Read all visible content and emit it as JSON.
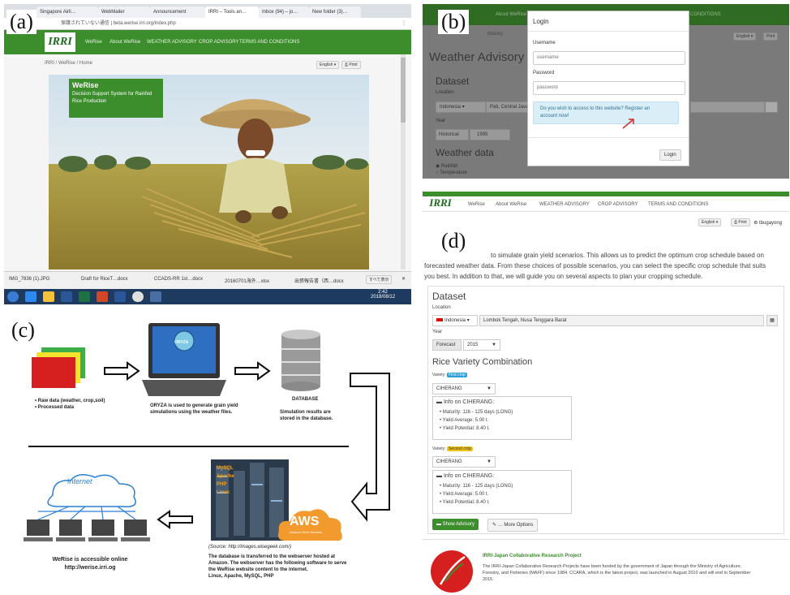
{
  "labels": {
    "a": "(a)",
    "b": "(b)",
    "c": "(c)",
    "d": "(d)"
  },
  "panel_a": {
    "tabs": [
      "Singapore Airli…",
      "WebMailer",
      "Announcement",
      "IRRI – Tools an…",
      "Inbox (94) – jo…",
      "New folder (3)…"
    ],
    "address": "保護されていない通信 | beta.werise.irri.org/index.php",
    "logo": "IRRI",
    "nav": [
      "WeRise",
      "About WeRise",
      "WEATHER ADVISORY",
      "CROP ADVISORY",
      "TERMS AND CONDITIONS"
    ],
    "breadcrumb": "IRRI / WeRise / Home",
    "lang": "English ▾",
    "print": "Print",
    "hero_title": "WeRise",
    "hero_sub": "Decision Support System for Rainfed Rice Production",
    "downloads": [
      "IMG_7836 (1).JPG",
      "Draft for RiceT…docx",
      "CCADS-RR 1st…docx",
      "20160701海外…xlsx",
      "出張報告書（西…docx"
    ],
    "show_all": "すべて表示",
    "clock": "2:42",
    "date": "2018/08/12"
  },
  "panel_b": {
    "bg_title": "Weather Advisory",
    "bg_dataset": "Dataset",
    "bg_location": "Location",
    "bg_country": "Indonesia ▾",
    "bg_region": "Pati, Central Java",
    "bg_year": "Year",
    "bg_hist": "Historical",
    "bg_year_val": "1995",
    "bg_weather": "Weather data",
    "bg_rain": "Rainfall",
    "bg_temp": "Temperature",
    "bg_nav_1": "About WeRise",
    "bg_nav_2": "CONDITIONS",
    "bg_advisory": "dvisory",
    "bg_english": "English ▾",
    "bg_print": "Print",
    "login_title": "Login",
    "username_label": "Username",
    "username_ph": "username",
    "password_label": "Password",
    "password_ph": "password",
    "msg_1": "Do you wish to access to this website? Register an",
    "msg_2": "account now!",
    "login_btn": "Login"
  },
  "panel_c": {
    "raw_1": "• Raw data (weather, crop,soil)",
    "raw_2": "• Processed data",
    "oryza": "ORYZA",
    "oryza_desc_1": "ORYZA is used to generate grain yield",
    "oryza_desc_2": "simulations using the weather files.",
    "db": "DATABASE",
    "db_desc_1": "Simulation results are",
    "db_desc_2": "stored in the database.",
    "internet": "Internet",
    "access_1": "WeRise is accessible online",
    "access_2": "http://werise.irri.og",
    "server_labels": [
      "MySQL",
      "Apache",
      "PHP",
      "Linux"
    ],
    "aws": "AWS",
    "aws_sub": "Amazon Web Services",
    "source": "(Source: http://images.wisegeek.com/)",
    "aws_desc_1": "The database is transferred to the webserver hosted at",
    "aws_desc_2": "Amazon. The webserver has the following software to serve",
    "aws_desc_3": "the WeRise website content to the internet.",
    "aws_desc_4": "Linux, Apache, MySQL, PHP"
  },
  "panel_d": {
    "logo": "IRRI",
    "nav": [
      "WeRise",
      "About WeRise",
      "WEATHER ADVISORY",
      "CROP ADVISORY",
      "TERMS AND CONDITIONS"
    ],
    "lang": "English ▾",
    "print": "Print",
    "user": "tbugayong",
    "intro_1": "to simulate grain yield scenarios. This allows us to predict the optimum crop schedule based on",
    "intro_2": "forecasted weather data. From these choices of possible scenarios, you can select the specific crop schedule that suits",
    "intro_3": "you best. In addition to that, we will guide you on several aspects to plan your cropping schedule.",
    "dataset": "Dataset",
    "location": "Location",
    "country": "Indonesia ▾",
    "region": "Lombok Tengah, Nusa Tenggara Barat",
    "year": "Year",
    "forecast": "Forecast",
    "year_val": "2015",
    "rice_var": "Rice Variety Combination",
    "variety_label": "Variety:",
    "first_crop": "First crop",
    "second_crop": "Second crop",
    "variety_val": "CIHERANG",
    "info_title": "Info on CIHERANG:",
    "maturity": "Maturity: 116 - 125 days (LONG)",
    "avg": "Yield Average: 5.00 t.",
    "potential": "Yield Potential: 8.40 t.",
    "show_btn": "Show Advisory",
    "more_btn": "… More Options",
    "collab_title": "IRRI-Japan Collaborative Research Project",
    "collab_1": "The IRRI-Japan Collaborative Research Projects have been funded by the government of Japan through the Ministry of Agriculture,",
    "collab_2": "Forestry, and Fisheries (MAFF) since 1984. CCARA, which is the latest project, was launched in August 2010 and will end in September",
    "collab_3": "2015."
  },
  "colors": {
    "brand_green": "#3c8d2c",
    "aws_orange": "#f29a2e",
    "info_blue": "#d9eef7",
    "badge_blue": "#2a9fd6",
    "badge_yellow": "#f0c419"
  }
}
